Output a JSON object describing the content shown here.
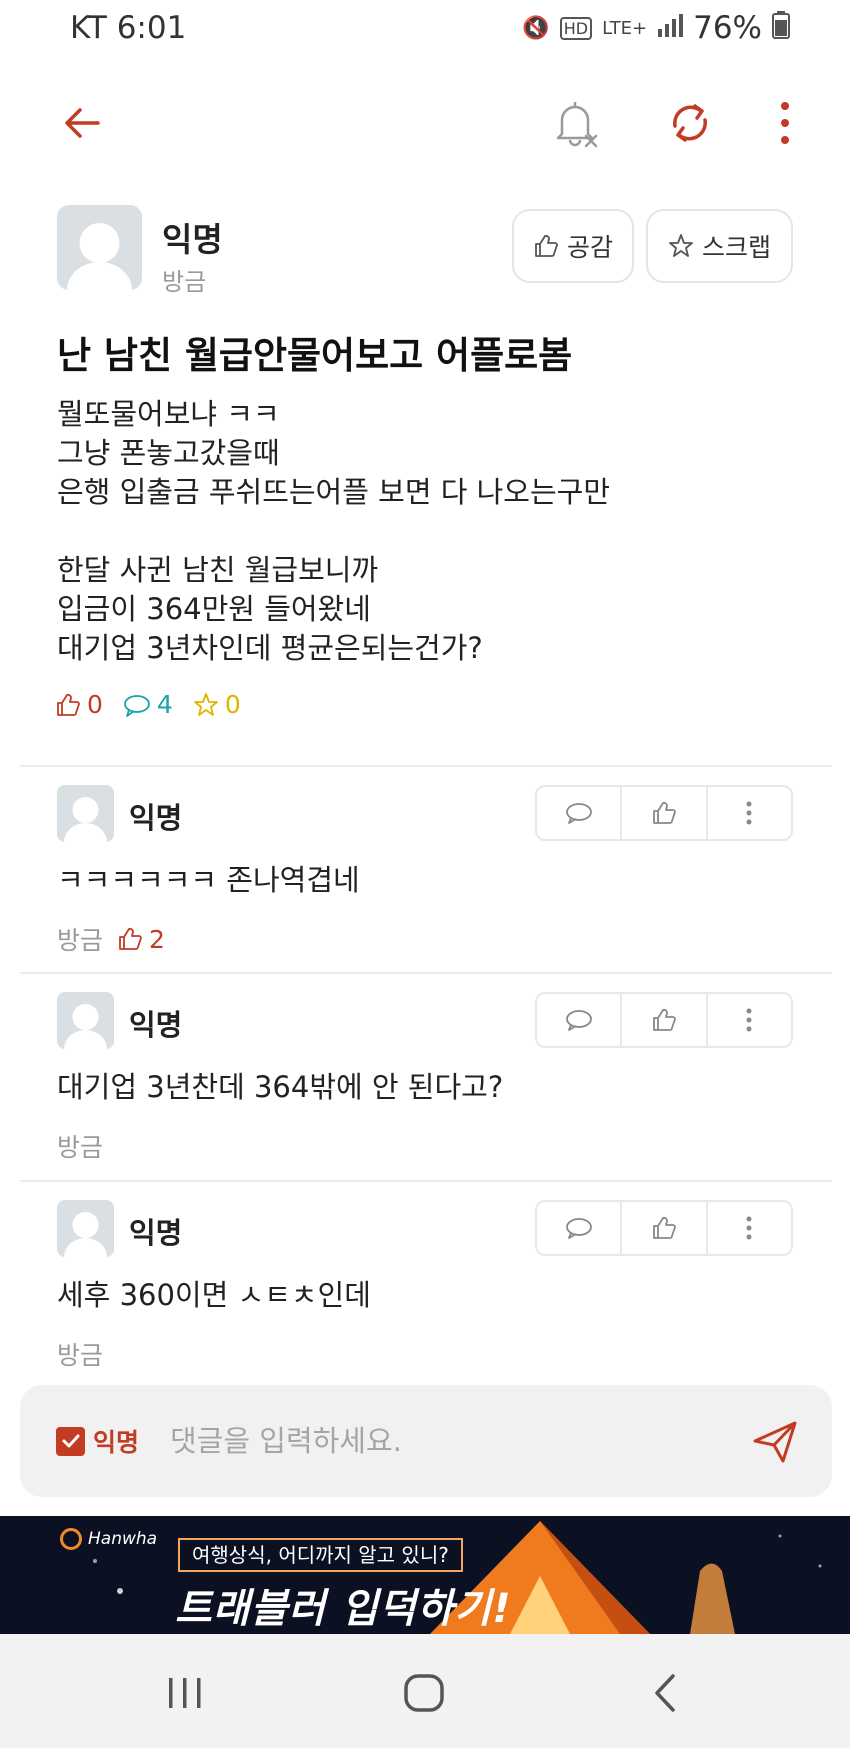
{
  "status_bar": {
    "carrier_time": "KT 6:01",
    "network": "LTE+",
    "battery": "76%"
  },
  "post": {
    "author": "익명",
    "time": "방금",
    "like_button": "공감",
    "scrap_button": "스크랩",
    "title": "난 남친 월급안물어보고 어플로봄",
    "body": "뭘또물어보냐 ㅋㅋ\n그냥 폰놓고갔을때\n은행 입출금 푸쉬뜨는어플 보면 다 나오는구만\n\n한달 사귄 남친 월급보니까\n입금이 364만원 들어왔네\n대기업 3년차인데 평균은되는건가?",
    "stats": {
      "likes": "0",
      "comments": "4",
      "scraps": "0"
    }
  },
  "comments": [
    {
      "author": "익명",
      "text": "ㅋㅋㅋㅋㅋㅋ 존나역겹네",
      "time": "방금",
      "likes": "2"
    },
    {
      "author": "익명",
      "text": "대기업 3년찬데 364밖에 안 된다고?",
      "time": "방금"
    },
    {
      "author": "익명",
      "text": "세후 360이면 ㅅㅌㅊ인데",
      "time": "방금"
    }
  ],
  "comment_input": {
    "anonymous_label": "익명",
    "placeholder": "댓글을 입력하세요."
  },
  "ad_banner": {
    "brand": "Hanwha",
    "subtitle": "여행상식, 어디까지 알고 있니?",
    "headline": "트래블러 입덕하기!"
  },
  "colors": {
    "accent": "#c23b22",
    "comment_stat": "#1aa3a3",
    "scrap_stat": "#e0b400"
  }
}
